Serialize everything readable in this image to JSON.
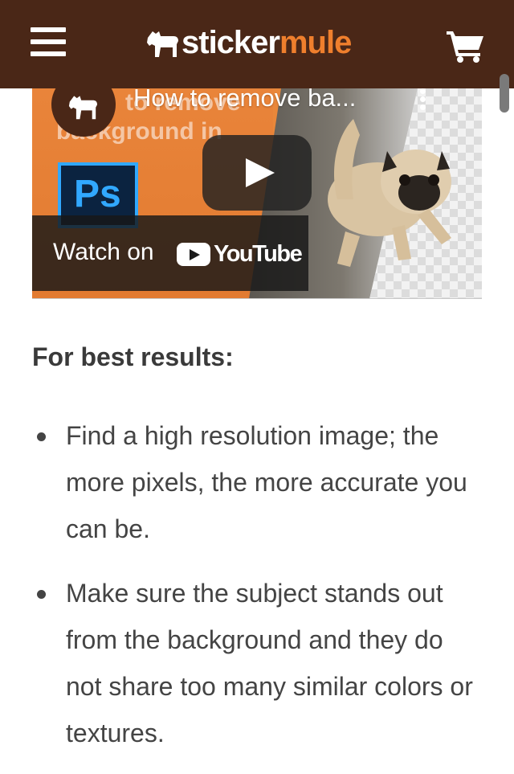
{
  "header": {
    "logo_part1": "sticker",
    "logo_part2": "mule",
    "menu_icon": "hamburger-menu-icon",
    "cart_icon": "shopping-cart-icon",
    "background_color": "#4a2717",
    "accent_color": "#ef7f2d"
  },
  "video": {
    "title": "How to remove ba...",
    "thumbnail_text_line1": "to remove",
    "thumbnail_text_line2": "background in",
    "ps_logo_text": "Ps",
    "watch_on_label": "Watch on",
    "youtube_label": "YouTube",
    "play_icon": "play-icon",
    "more_icon": "more-vertical-icon"
  },
  "article": {
    "heading": "For best results:",
    "tips": [
      "Find a high resolution image; the more pixels, the more accurate you can be.",
      "Make sure the subject stands out from the background and they do not share too many similar colors or textures."
    ]
  }
}
